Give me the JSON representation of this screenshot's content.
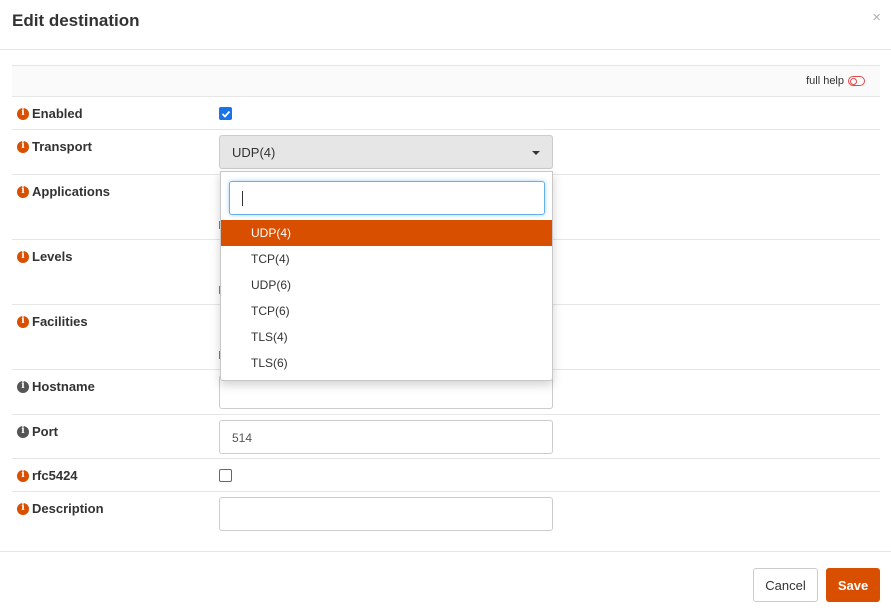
{
  "modal": {
    "title": "Edit destination",
    "close_glyph": "×",
    "full_help_label": "full help"
  },
  "fields": {
    "enabled": {
      "label": "Enabled",
      "checked": true
    },
    "transport": {
      "label": "Transport",
      "value": "UDP(4)"
    },
    "applications": {
      "label": "Applications"
    },
    "levels": {
      "label": "Levels"
    },
    "facilities": {
      "label": "Facilities"
    },
    "hostname": {
      "label": "Hostname",
      "value": ""
    },
    "port": {
      "label": "Port",
      "value": "514"
    },
    "rfc5424": {
      "label": "rfc5424",
      "checked": false
    },
    "description": {
      "label": "Description",
      "value": ""
    }
  },
  "transport_dropdown": {
    "search_value": "",
    "options": [
      "UDP(4)",
      "TCP(4)",
      "UDP(6)",
      "TCP(6)",
      "TLS(4)",
      "TLS(6)"
    ],
    "selected": "UDP(4)"
  },
  "footer": {
    "cancel_label": "Cancel",
    "save_label": "Save"
  },
  "colors": {
    "accent": "#d94f00",
    "checkbox": "#1a73e8"
  },
  "icons": {
    "info": "info-circle-icon",
    "close": "close-icon",
    "help_toggle": "toggle-icon",
    "caret": "caret-down-icon"
  }
}
